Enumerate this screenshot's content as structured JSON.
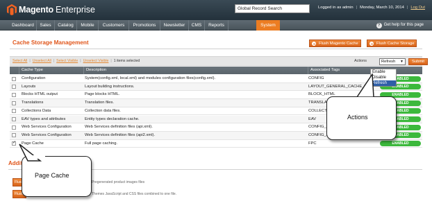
{
  "app": {
    "logo_bold": "Magento",
    "logo_light": "Enterprise",
    "search_value": "Global Record Search",
    "logged_in": "Logged in as admin",
    "date": "Monday, March 10, 2014",
    "logout": "Log Out"
  },
  "nav": {
    "items": [
      "Dashboard",
      "Sales",
      "Catalog",
      "Mobile",
      "Customers",
      "Promotions",
      "Newsletter",
      "CMS",
      "Reports",
      "System"
    ],
    "active": "System",
    "help": "Get help for this page"
  },
  "page": {
    "title": "Cache Storage Management",
    "flush_magento": "Flush Magento Cache",
    "flush_storage": "Flush Cache Storage"
  },
  "massaction": {
    "select_all": "Select All",
    "unselect_all": "Unselect All",
    "select_visible": "Select Visible",
    "unselect_visible": "Unselect Visible",
    "selected": "1 items selected",
    "actions_label": "Actions",
    "selected_action": "Refresh",
    "options": [
      "Enable",
      "Disable",
      "Refresh"
    ],
    "submit": "Submit"
  },
  "grid": {
    "headers": [
      "Cache Type",
      "Description",
      "Associated Tags"
    ],
    "rows": [
      {
        "type": "Configuration",
        "desc": "System(config.xml, local.xml) and modules configuration files(config.xml).",
        "tags": "CONFIG",
        "status": "ENABLED",
        "checked": false
      },
      {
        "type": "Layouts",
        "desc": "Layout building instructions.",
        "tags": "LAYOUT_GENERAL_CACHE_TAG",
        "status": "ENABLED",
        "checked": false
      },
      {
        "type": "Blocks HTML output",
        "desc": "Page blocks HTML.",
        "tags": "BLOCK_HTML",
        "status": "ENABLED",
        "checked": false
      },
      {
        "type": "Translations",
        "desc": "Translation files.",
        "tags": "TRANSLATE",
        "status": "ENABLED",
        "checked": false
      },
      {
        "type": "Collections Data",
        "desc": "Collection data files.",
        "tags": "COLLECTION_DATA",
        "status": "ENABLED",
        "checked": false
      },
      {
        "type": "EAV types and attributes",
        "desc": "Entity types declaration cache.",
        "tags": "EAV",
        "status": "ENABLED",
        "checked": false
      },
      {
        "type": "Web Services Configuration",
        "desc": "Web Services definition files (api.xml).",
        "tags": "CONFIG_API",
        "status": "ENABLED",
        "checked": false
      },
      {
        "type": "Web Services Configuration",
        "desc": "Web Services definition files (api2.xml).",
        "tags": "CONFIG_API2",
        "status": "ENABLED",
        "checked": false
      },
      {
        "type": "Page Cache",
        "desc": "Full page caching.",
        "tags": "FPC",
        "status": "ENABLED",
        "checked": true
      }
    ]
  },
  "additional": {
    "title": "Additional Cache Management",
    "btn1": "Flush Catalog Images Cache",
    "btn2": "Flush JavaScript/CSS Cache",
    "text1": "Pregenerated product images files",
    "text2": "Themes JavaScript and CSS files combined to one file."
  },
  "callouts": {
    "actions": "Actions",
    "page_cache": "Page Cache"
  },
  "colors": {
    "accent": "#ec7d22",
    "title": "#e0561b",
    "enabled": "#3cb83c",
    "header": "#2b3a44"
  }
}
